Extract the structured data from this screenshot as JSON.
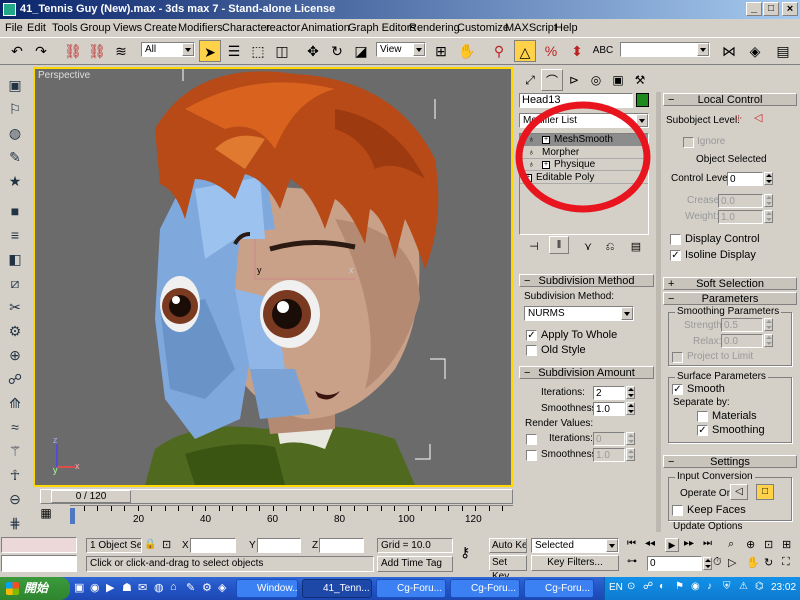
{
  "window": {
    "title": "41_Tennis Guy (New).max - 3ds max 7 - Stand-alone License",
    "controls": [
      "_",
      "□",
      "×"
    ]
  },
  "menu": [
    "File",
    "Edit",
    "Tools",
    "Group",
    "Views",
    "Create",
    "Modifiers",
    "Character",
    "reactor",
    "Animation",
    "Graph Editors",
    "Rendering",
    "Customize",
    "MAXScript",
    "Help"
  ],
  "toolbar": {
    "selection_filter": "All",
    "reference_coord": "View",
    "named_selection": ""
  },
  "viewport": {
    "label": "Perspective",
    "axis_x": "x",
    "axis_y": "y",
    "axis_z": "z",
    "gizmo_x": "x",
    "gizmo_y": "y"
  },
  "command_panel": {
    "object_name": "Head13",
    "object_color": "#1e8a1e",
    "modifier_list": "Modifier List",
    "stack": [
      {
        "name": "MeshSmooth",
        "selected": true
      },
      {
        "name": "Morpher",
        "selected": false
      },
      {
        "name": "Physique",
        "selected": false
      },
      {
        "name": "Editable Poly",
        "selected": false
      }
    ],
    "subdivision_method": {
      "title": "Subdivision Method",
      "label": "Subdivision Method:",
      "value": "NURMS",
      "apply_to_whole": "Apply To Whole",
      "apply_to_whole_checked": true,
      "old_style": "Old Style",
      "old_style_checked": false
    },
    "subdivision_amount": {
      "title": "Subdivision Amount",
      "iterations_label": "Iterations:",
      "iterations": "2",
      "smoothness_label": "Smoothness:",
      "smoothness": "1.0",
      "render_values": "Render Values:",
      "r_iterations_label": "Iterations:",
      "r_iterations": "0",
      "r_smoothness_label": "Smoothness:",
      "r_smoothness": "1.0"
    },
    "local_control": {
      "title": "Local Control",
      "subobject_level": "Subobject Level:",
      "ignore": "Ignore",
      "object_selected": "Object Selected",
      "control_level_label": "Control Level:",
      "control_level": "0",
      "crease_label": "Crease:",
      "crease": "0.0",
      "weight_label": "Weight:",
      "weight": "1.0",
      "display_control": "Display Control",
      "isoline_display": "Isoline Display"
    },
    "soft_selection": {
      "title": "Soft Selection"
    },
    "parameters": {
      "title": "Parameters",
      "smoothing_params": "Smoothing Parameters",
      "strength_label": "Strength:",
      "strength": "0.5",
      "relax_label": "Relax:",
      "relax": "0.0",
      "project_to_limit": "Project to Limit",
      "surface_params": "Surface Parameters",
      "smooth": "Smooth",
      "separate_by": "Separate by:",
      "materials": "Materials",
      "smoothing": "Smoothing"
    },
    "settings": {
      "title": "Settings",
      "input_conversion": "Input Conversion",
      "operate_on": "Operate On:",
      "keep_faces": "Keep Faces",
      "update_options": "Update Options"
    }
  },
  "timeline": {
    "frame": "0 / 120",
    "ticks": [
      "0",
      "20",
      "40",
      "60",
      "80",
      "100",
      "120"
    ]
  },
  "status": {
    "selection": "1 Object Se",
    "x_label": "X",
    "y_label": "Y",
    "z_label": "Z",
    "x": "",
    "y": "",
    "z": "",
    "grid": "Grid = 10.0",
    "add_time_tag": "Add Time Tag",
    "prompt": "Click or click-and-drag to select objects",
    "auto_key": "Auto Key",
    "set_key": "Set Key",
    "selected": "Selected",
    "key_filters": "Key Filters...",
    "frame_field": "0"
  },
  "taskbar": {
    "start": "開始",
    "tasks": [
      "Window...",
      "41_Tenn...",
      "Cg-Foru...",
      "Cg-Foru...",
      "Cg-Foru..."
    ],
    "lang": "EN",
    "clock": "23:02"
  },
  "colors": {
    "annotation_circle": "#e8141e",
    "xp_taskbar": "#2456c8",
    "title_bar": "#0a246a"
  }
}
